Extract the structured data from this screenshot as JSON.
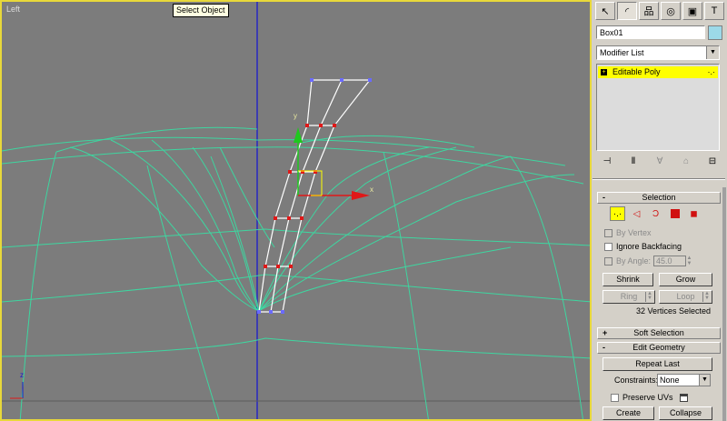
{
  "viewport": {
    "label": "Left"
  },
  "tooltip": "Select Object",
  "axis_gizmo": {
    "x": "x",
    "y": "y",
    "z": "z"
  },
  "panel": {
    "tabs": [
      {
        "name": "create-tab-icon",
        "glyph": "↖"
      },
      {
        "name": "modify-tab-icon",
        "glyph": "◜"
      },
      {
        "name": "hierarchy-tab-icon",
        "glyph": "品"
      },
      {
        "name": "motion-tab-icon",
        "glyph": "◎"
      },
      {
        "name": "display-tab-icon",
        "glyph": "▣"
      },
      {
        "name": "utilities-tab-icon",
        "glyph": "T"
      }
    ],
    "object_name": "Box01",
    "object_color": "#9cd9e8",
    "modifier_list": "Modifier List",
    "stack_item": "Editable Poly",
    "selection": {
      "title": "Selection",
      "by_vertex": "By Vertex",
      "ignore_backfacing": "Ignore Backfacing",
      "by_angle": "By Angle:",
      "angle_value": "45.0",
      "shrink": "Shrink",
      "grow": "Grow",
      "ring": "Ring",
      "loop": "Loop",
      "status": "32 Vertices Selected"
    },
    "soft_selection": {
      "title": "Soft Selection",
      "sign": "+"
    },
    "edit_geometry": {
      "title": "Edit Geometry",
      "sign": "-",
      "repeat_last": "Repeat Last",
      "constraints_label": "Constraints:",
      "constraints_value": "None",
      "preserve_uvs": "Preserve UVs",
      "create": "Create",
      "collapse": "Collapse"
    }
  },
  "colors": {
    "viewport_border": "#e8d83a",
    "highlight": "#ffff00",
    "wire": "#3ed6a0"
  }
}
